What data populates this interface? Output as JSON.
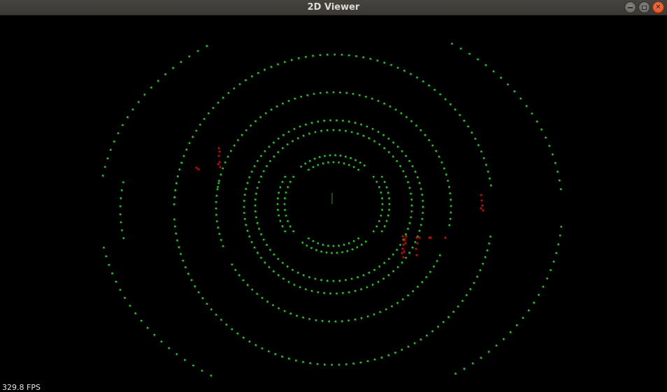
{
  "window": {
    "title": "2D Viewer",
    "controls": {
      "minimize_icon": "minimize-icon",
      "maximize_icon": "maximize-icon",
      "close_icon": "close-icon",
      "close_glyph": "✕"
    }
  },
  "viewer": {
    "background_color": "#000000",
    "point_color": "#00e000",
    "obstacle_color": "#e00000",
    "origin_marker_color": "#1aa11a"
  },
  "status": {
    "fps_text": "329.8 FPS"
  }
}
